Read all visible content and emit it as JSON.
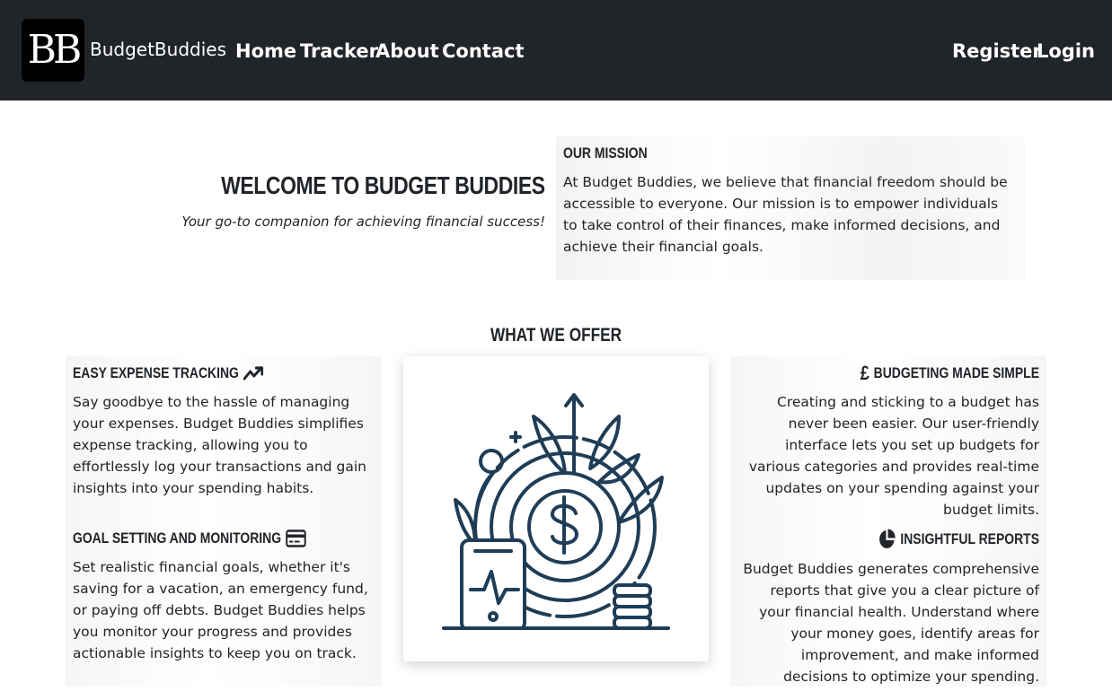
{
  "nav": {
    "logo_text": "BB",
    "brand": "BudgetBuddies",
    "links": [
      "Home",
      "Tracker",
      "About",
      "Contact"
    ],
    "auth": [
      "Register",
      "Login"
    ]
  },
  "hero": {
    "title": "WELCOME TO BUDGET BUDDIES",
    "subtitle": "Your go-to companion for achieving financial success!"
  },
  "mission": {
    "heading": "OUR MISSION",
    "body": "At Budget Buddies, we believe that financial freedom should be accessible to everyone. Our mission is to empower individuals to take control of their finances, make informed decisions, and achieve their financial goals."
  },
  "offer": {
    "title": "WHAT WE OFFER",
    "features": [
      {
        "heading": "EASY EXPENSE TRACKING",
        "icon": "trending-up-icon",
        "body": "Say goodbye to the hassle of managing your expenses. Budget Buddies simplifies expense tracking, allowing you to effortlessly log your transactions and gain insights into your spending habits."
      },
      {
        "heading": "BUDGETING MADE SIMPLE",
        "icon": "pound-icon",
        "body": "Creating and sticking to a budget has never been easier. Our user-friendly interface lets you set up budgets for various categories and provides real-time updates on your spending against your budget limits."
      },
      {
        "heading": "GOAL SETTING AND MONITORING",
        "icon": "credit-card-icon",
        "body": "Set realistic financial goals, whether it's saving for a vacation, an emergency fund, or paying off debts. Budget Buddies helps you monitor your progress and provides actionable insights to keep you on track."
      },
      {
        "heading": "INSIGHTFUL REPORTS",
        "icon": "pie-chart-icon",
        "body": "Budget Buddies generates comprehensive reports that give you a clear picture of your financial health. Understand where your money goes, identify areas for improvement, and make informed decisions to optimize your spending."
      }
    ],
    "illustration": "money-growth-illustration"
  },
  "colors": {
    "navbar": "#212529",
    "illustration_stroke": "#1f3d56"
  }
}
